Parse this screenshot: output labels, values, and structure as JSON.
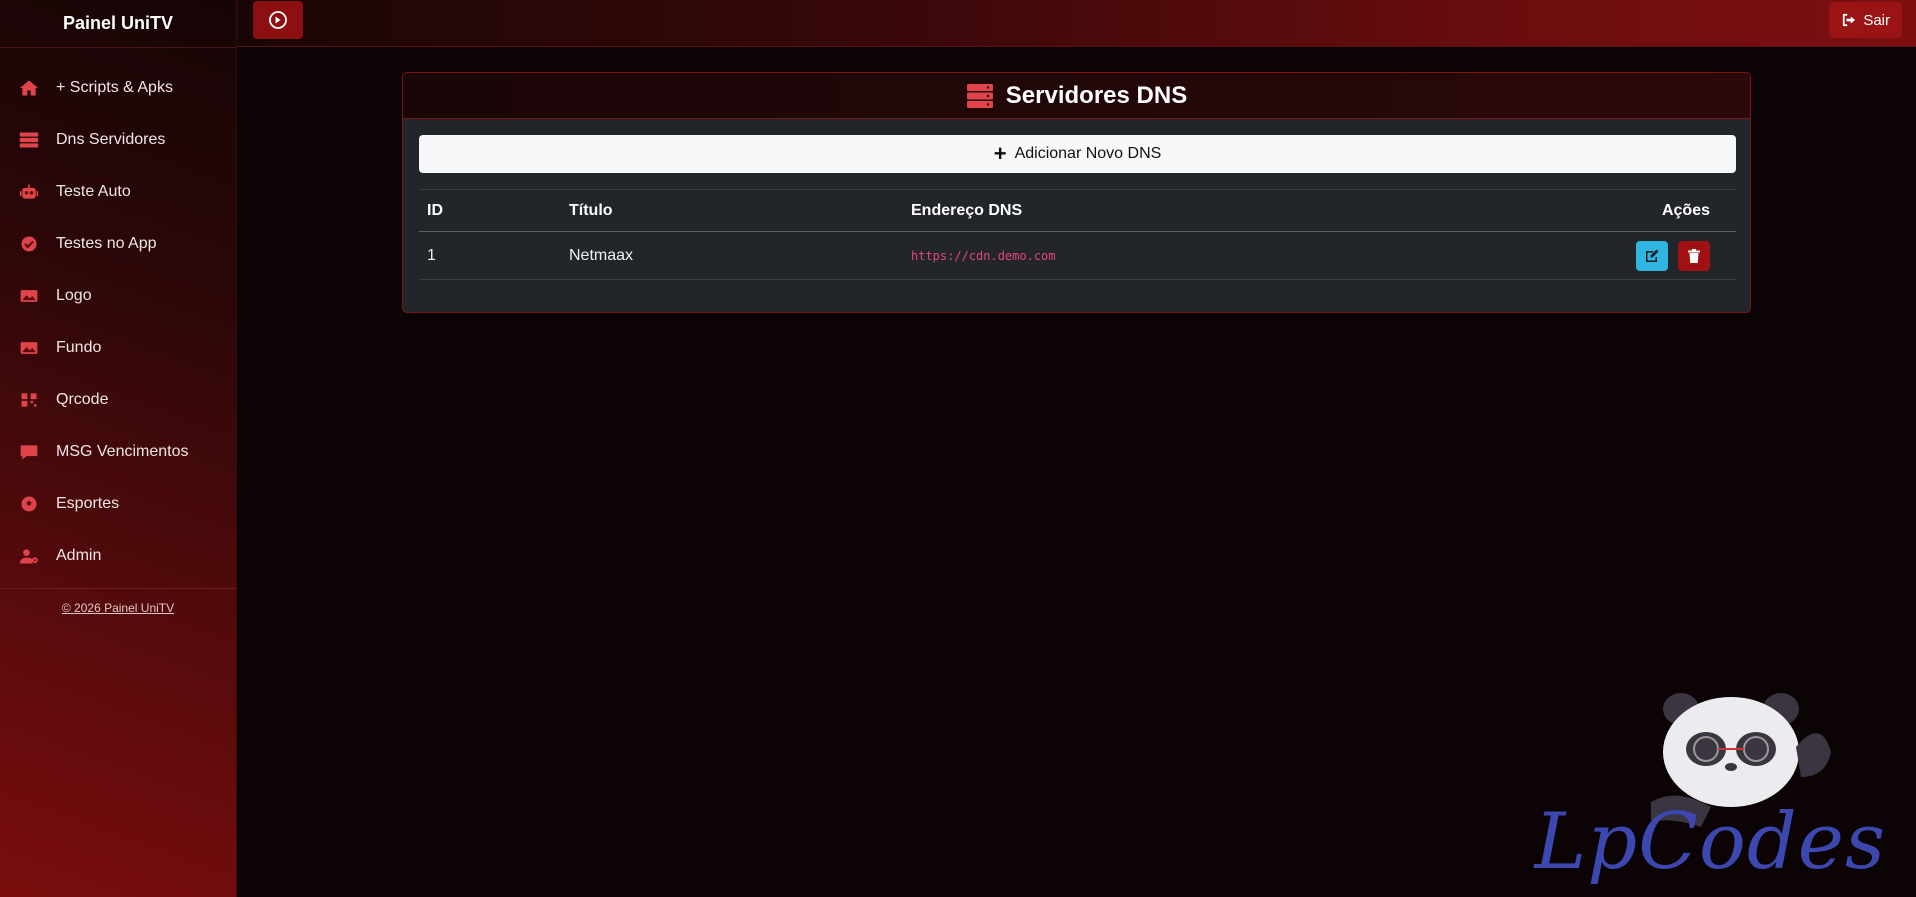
{
  "sidebar": {
    "brand": "Painel UniTV",
    "items": [
      {
        "label": "+ Scripts & Apks",
        "icon": "home-icon"
      },
      {
        "label": "Dns Servidores",
        "icon": "server-icon"
      },
      {
        "label": "Teste Auto",
        "icon": "robot-icon"
      },
      {
        "label": "Testes no App",
        "icon": "check-circle-icon"
      },
      {
        "label": "Logo",
        "icon": "image-icon"
      },
      {
        "label": "Fundo",
        "icon": "image-icon"
      },
      {
        "label": "Qrcode",
        "icon": "qrcode-icon"
      },
      {
        "label": "MSG Vencimentos",
        "icon": "comment-icon"
      },
      {
        "label": "Esportes",
        "icon": "soccer-ball-icon"
      },
      {
        "label": "Admin",
        "icon": "user-cog-icon"
      }
    ],
    "footer": "© 2026 Painel UniTV"
  },
  "topbar": {
    "toggle_icon": "sidebar-toggle-icon",
    "logout_label": "Sair"
  },
  "card": {
    "title": "Servidores DNS",
    "add_button": "Adicionar Novo DNS",
    "table": {
      "headers": [
        "ID",
        "Título",
        "Endereço DNS",
        "Ações"
      ],
      "rows": [
        {
          "id": "1",
          "titulo": "Netmaax",
          "dns": "https://cdn.demo.com"
        }
      ]
    }
  },
  "watermark": {
    "text": "LpCodes"
  },
  "colors": {
    "accent": "#9a1416",
    "edit": "#2eb6e0",
    "delete": "#a11013",
    "dns_text": "#e2457d"
  }
}
